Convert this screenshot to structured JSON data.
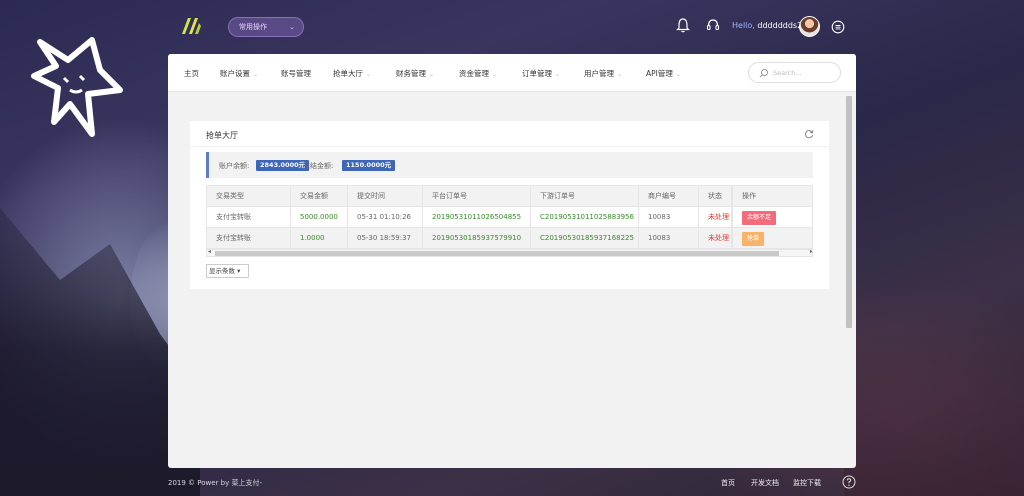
{
  "header": {
    "quick_button": "常用操作",
    "greeting_prefix": "Hello,",
    "username": "ddddddds2",
    "icons": [
      "bell-icon",
      "headset-icon",
      "menu-icon"
    ]
  },
  "nav": {
    "items": [
      {
        "label": "主页",
        "has_arrow": false
      },
      {
        "label": "账户设置",
        "has_arrow": true
      },
      {
        "label": "账号管理",
        "has_arrow": false
      },
      {
        "label": "抢单大厅",
        "has_arrow": true
      },
      {
        "label": "财务管理",
        "has_arrow": true
      },
      {
        "label": "资金管理",
        "has_arrow": true
      },
      {
        "label": "订单管理",
        "has_arrow": true
      },
      {
        "label": "用户管理",
        "has_arrow": true
      },
      {
        "label": "API管理",
        "has_arrow": true
      }
    ],
    "search_placeholder": "Search..."
  },
  "card": {
    "title": "抢单大厅",
    "balance_label": "账户余额:",
    "balance_value": "2843.0000元",
    "frozen_label": "冻结金额:",
    "frozen_value": "1150.0000元"
  },
  "table": {
    "columns": [
      "交易类型",
      "交易金额",
      "提交时间",
      "平台订单号",
      "下游订单号",
      "商户编号",
      "状态",
      "操作"
    ],
    "rows": [
      {
        "type": "支付宝转账",
        "amount": "5000.0000",
        "time": "05-31 01:10:26",
        "platform_no": "20190531011026504855",
        "downstream_no": "C20190531011025883956",
        "merchant": "10083",
        "status": "未处理",
        "action": "余额不足",
        "action_color": "#f26c7b"
      },
      {
        "type": "支付宝转账",
        "amount": "1.0000",
        "time": "05-30 18:59:37",
        "platform_no": "20190530185937579910",
        "downstream_no": "C20190530185937168225",
        "merchant": "10083",
        "status": "未处理",
        "action": "抢单",
        "action_color": "#f7b36a"
      }
    ],
    "page_size_label": "显示条数"
  },
  "footer": {
    "copyright": "2019 © Power by 菜上支付-",
    "links": [
      "首页",
      "开发文档",
      "监控下载"
    ]
  },
  "colors": {
    "accent_blue": "#3d65b8",
    "amount_green": "#3a8a2a",
    "status_red": "#e03a3a"
  }
}
